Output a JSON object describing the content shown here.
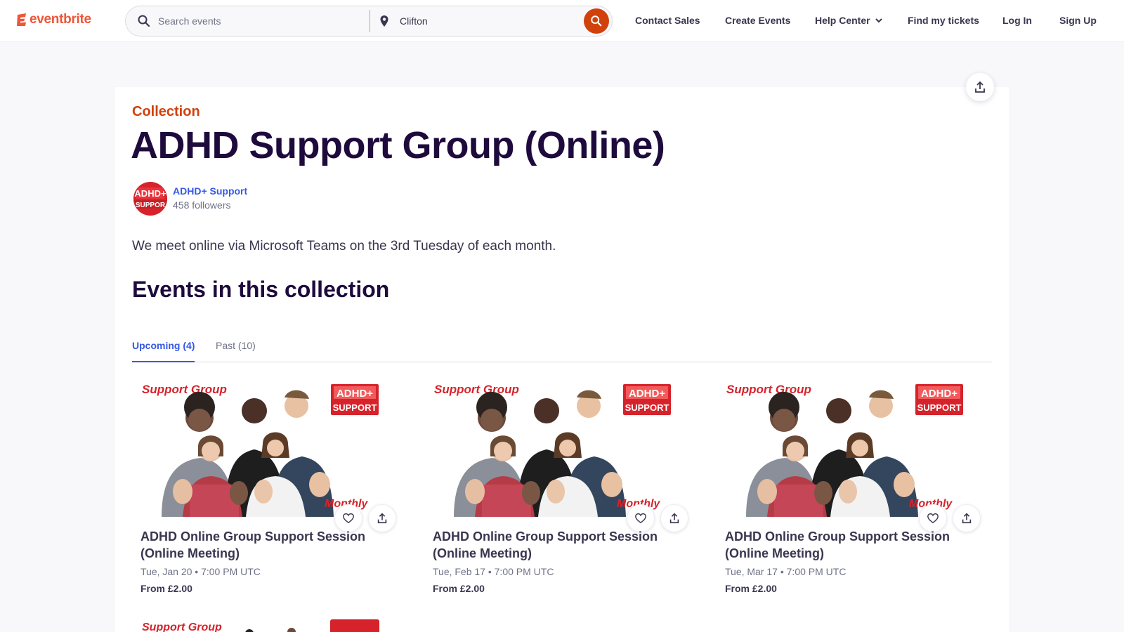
{
  "header": {
    "logo_text": "eventbrite",
    "search_placeholder": "Search events",
    "location_value": "Clifton",
    "nav": {
      "contact_sales": "Contact Sales",
      "create_events": "Create Events",
      "help_center": "Help Center",
      "find_tickets": "Find my tickets",
      "log_in": "Log In",
      "sign_up": "Sign Up"
    }
  },
  "collection": {
    "eyebrow": "Collection",
    "title": "ADHD Support Group (Online)",
    "organizer": {
      "name": "ADHD+ Support",
      "followers": "458 followers",
      "avatar_text": "ADHD+ SUPPORT"
    },
    "description": "We meet online via Microsoft Teams on the 3rd Tuesday of each month.",
    "events_heading": "Events in this collection"
  },
  "tabs": {
    "upcoming": "Upcoming (4)",
    "past": "Past (10)"
  },
  "event_image_text": {
    "support_group": "Support Group",
    "badge_line1": "ADHD+",
    "badge_line2": "SUPPORT",
    "monthly": "Monthly"
  },
  "events": [
    {
      "title": "ADHD Online Group Support Session (Online Meeting)",
      "date": "Tue, Jan 20 • 7:00 PM UTC",
      "price": "From £2.00"
    },
    {
      "title": "ADHD Online Group Support Session (Online Meeting)",
      "date": "Tue, Feb 17 • 7:00 PM UTC",
      "price": "From £2.00"
    },
    {
      "title": "ADHD Online Group Support Session (Online Meeting)",
      "date": "Tue, Mar 17 • 7:00 PM UTC",
      "price": "From £2.00"
    }
  ],
  "colors": {
    "brand_orange": "#f05537",
    "search_button": "#d1410c",
    "link_blue": "#3659e3",
    "heading": "#1e0a3c",
    "badge_red": "#d6232b"
  },
  "icons": {
    "search": "search-icon",
    "location": "location-pin-icon",
    "share": "share-upload-icon",
    "like": "heart-icon",
    "chevron": "chevron-down-icon"
  }
}
